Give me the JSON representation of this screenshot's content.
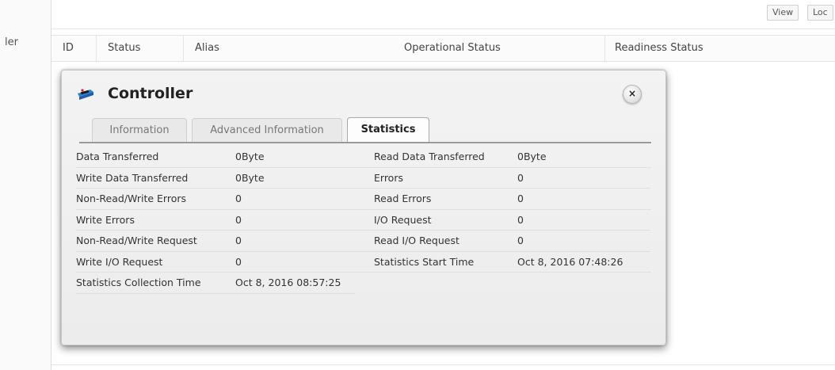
{
  "sidebar": {
    "label": "ler"
  },
  "toolbar": {
    "view_label": "View",
    "loc_label": "Loc"
  },
  "table": {
    "columns": [
      "ID",
      "Status",
      "Alias",
      "Operational Status",
      "Readiness Status"
    ]
  },
  "dialog": {
    "title": "Controller",
    "close_label": "×",
    "tabs": [
      "Information",
      "Advanced Information",
      "Statistics"
    ],
    "active_tab": "Statistics",
    "stats": [
      {
        "label1": "Data Transferred",
        "value1": "0Byte",
        "label2": "Read Data Transferred",
        "value2": "0Byte"
      },
      {
        "label1": "Write Data Transferred",
        "value1": "0Byte",
        "label2": "Errors",
        "value2": "0"
      },
      {
        "label1": "Non-Read/Write Errors",
        "value1": "0",
        "label2": "Read Errors",
        "value2": "0"
      },
      {
        "label1": "Write Errors",
        "value1": "0",
        "label2": "I/O Request",
        "value2": "0"
      },
      {
        "label1": "Non-Read/Write Request",
        "value1": "0",
        "label2": "Read I/O Request",
        "value2": "0"
      },
      {
        "label1": "Write I/O Request",
        "value1": "0",
        "label2": "Statistics Start Time",
        "value2": "Oct 8, 2016 07:48:26"
      },
      {
        "label1": "Statistics Collection Time",
        "value1": "Oct 8, 2016 08:57:25",
        "label2": "",
        "value2": ""
      }
    ]
  },
  "colors": {
    "accent": "#1d5fa8",
    "tab_rule": "#9a9a9a"
  },
  "icons": {
    "controller": "controller-icon",
    "close": "close-icon"
  }
}
